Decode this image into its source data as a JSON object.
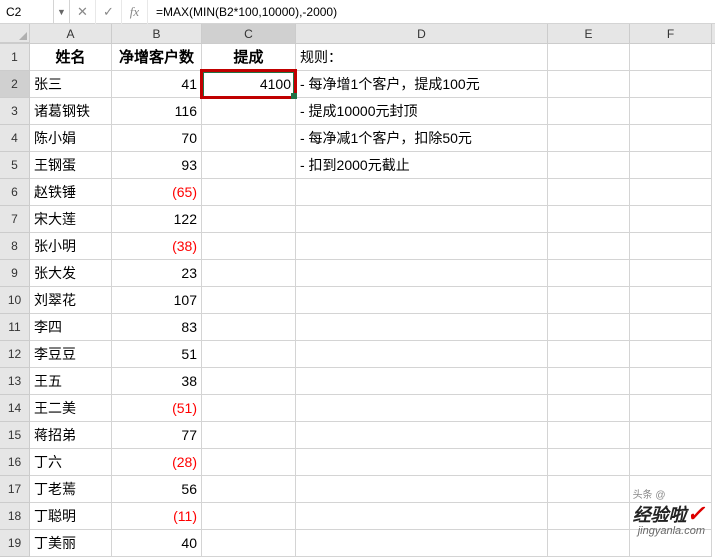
{
  "nameBox": "C2",
  "formula": "=MAX(MIN(B2*100,10000),-2000)",
  "columns": [
    "A",
    "B",
    "C",
    "D",
    "E",
    "F"
  ],
  "headers": {
    "A": "姓名",
    "B": "净增客户数",
    "C": "提成"
  },
  "rules": {
    "title": "规则：",
    "r1": "- 每净增1个客户，提成100元",
    "r2": "- 提成10000元封顶",
    "r3": "- 每净减1个客户，扣除50元",
    "r4": "- 扣到2000元截止"
  },
  "selectedValue": "4100",
  "rows": [
    {
      "n": "张三",
      "v": "41",
      "neg": false
    },
    {
      "n": "诸葛钢铁",
      "v": "116",
      "neg": false
    },
    {
      "n": "陈小娟",
      "v": "70",
      "neg": false
    },
    {
      "n": "王钢蛋",
      "v": "93",
      "neg": false
    },
    {
      "n": "赵铁锤",
      "v": "(65)",
      "neg": true
    },
    {
      "n": "宋大莲",
      "v": "122",
      "neg": false
    },
    {
      "n": "张小明",
      "v": "(38)",
      "neg": true
    },
    {
      "n": "张大发",
      "v": "23",
      "neg": false
    },
    {
      "n": "刘翠花",
      "v": "107",
      "neg": false
    },
    {
      "n": "李四",
      "v": "83",
      "neg": false
    },
    {
      "n": "李豆豆",
      "v": "51",
      "neg": false
    },
    {
      "n": "王五",
      "v": "38",
      "neg": false
    },
    {
      "n": "王二美",
      "v": "(51)",
      "neg": true
    },
    {
      "n": "蒋招弟",
      "v": "77",
      "neg": false
    },
    {
      "n": "丁六",
      "v": "(28)",
      "neg": true
    },
    {
      "n": "丁老蔫",
      "v": "56",
      "neg": false
    },
    {
      "n": "丁聪明",
      "v": "(11)",
      "neg": true
    },
    {
      "n": "丁美丽",
      "v": "40",
      "neg": false
    }
  ],
  "watermark": {
    "main": "经验啦",
    "check": "✓",
    "sub": "jingyanla.com",
    "attrib": "头条 @"
  }
}
